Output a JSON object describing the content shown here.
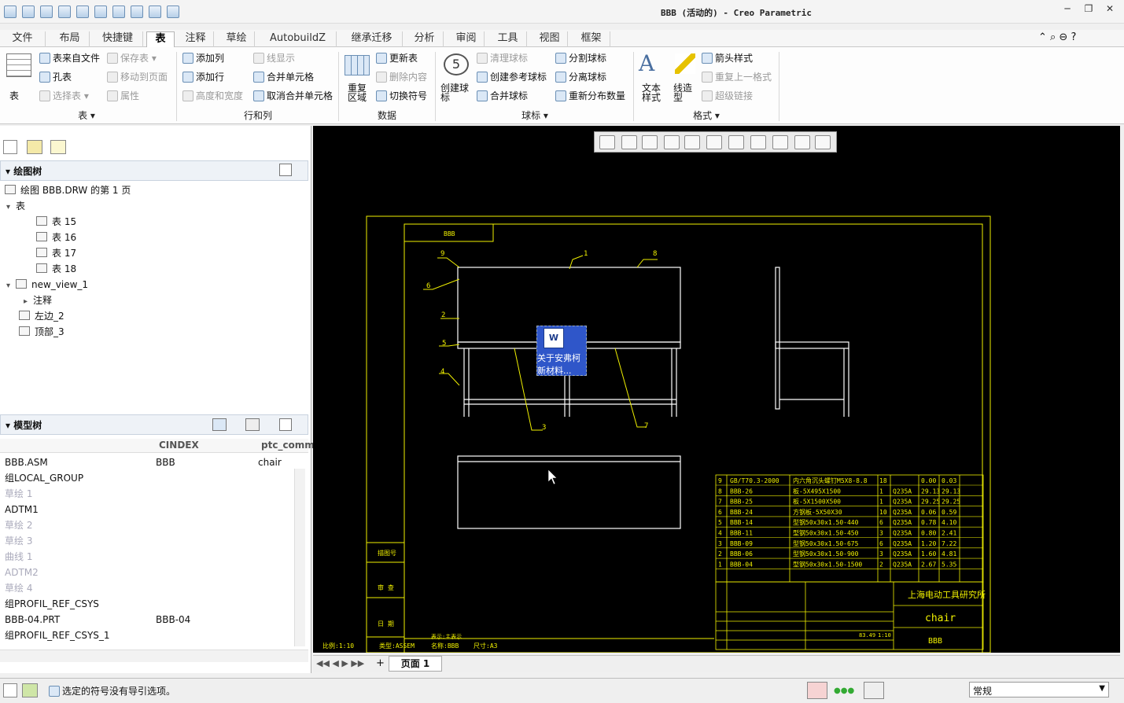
{
  "window": {
    "title": "BBB (活动的) - Creo Parametric",
    "minimize": "─",
    "restore": "❐",
    "close": "✕"
  },
  "menu_tabs": [
    "文件",
    "布局",
    "快捷键",
    "表",
    "注释",
    "草绘",
    "AutobuildZ",
    "继承迁移",
    "分析",
    "审阅",
    "工具",
    "视图",
    "框架"
  ],
  "ribbon": {
    "table_group": {
      "big": "表",
      "items": [
        "表来自文件",
        "孔表",
        "保存表",
        "移动到页面",
        "选择表",
        "属性"
      ],
      "label": "表"
    },
    "rowcol_group": {
      "items": [
        "添加列",
        "添加行",
        "高度和宽度",
        "线显示",
        "合并单元格",
        "取消合并单元格"
      ],
      "label": "行和列"
    },
    "data_group": {
      "big": "重复\n区域",
      "items": [
        "更新表",
        "删除内容",
        "切换符号"
      ],
      "label": "数据"
    },
    "balloon_group": {
      "big": "创建球\n标",
      "items": [
        "清理球标",
        "创建参考球标",
        "合并球标",
        "分割球标",
        "分离球标",
        "重新分布数量"
      ],
      "label": "球标"
    },
    "format_group": {
      "big1": "文本\n样式",
      "big2": "线造\n型",
      "items": [
        "箭头样式",
        "重复上一格式",
        "超级链接"
      ],
      "label": "格式"
    }
  },
  "drawing_tree": {
    "header": "绘图树",
    "root": "绘图 BBB.DRW 的第 1 页",
    "nodes": [
      "表",
      "表 15",
      "表 16",
      "表 17",
      "表 18",
      "new_view_1",
      "注释",
      "左边_2",
      "顶部_3"
    ]
  },
  "model_tree": {
    "header": "模型树",
    "columns": [
      "",
      "CINDEX",
      "ptc_comm"
    ],
    "rows": [
      {
        "name": "BBB.ASM",
        "c1": "BBB",
        "c2": "chair",
        "dim": false
      },
      {
        "name": "组LOCAL_GROUP",
        "c1": "",
        "c2": "",
        "dim": false
      },
      {
        "name": "草绘 1",
        "c1": "",
        "c2": "",
        "dim": true
      },
      {
        "name": "ADTM1",
        "c1": "",
        "c2": "",
        "dim": false
      },
      {
        "name": "草绘 2",
        "c1": "",
        "c2": "",
        "dim": true
      },
      {
        "name": "草绘 3",
        "c1": "",
        "c2": "",
        "dim": true
      },
      {
        "name": "曲线 1",
        "c1": "",
        "c2": "",
        "dim": true
      },
      {
        "name": "ADTM2",
        "c1": "",
        "c2": "",
        "dim": true
      },
      {
        "name": "草绘 4",
        "c1": "",
        "c2": "",
        "dim": true
      },
      {
        "name": "组PROFIL_REF_CSYS",
        "c1": "",
        "c2": "",
        "dim": false
      },
      {
        "name": "BBB-04.PRT",
        "c1": "BBB-04",
        "c2": "",
        "dim": false
      },
      {
        "name": "组PROFIL_REF_CSYS_1",
        "c1": "",
        "c2": "",
        "dim": false
      }
    ]
  },
  "drawing": {
    "title_box": "BBB",
    "balloons": [
      "1",
      "2",
      "3",
      "4",
      "5",
      "6",
      "7",
      "8",
      "9"
    ],
    "bom": [
      [
        "9",
        "GB/T70.3-2000",
        "内六角沉头螺钉M5X8-8.8",
        "18",
        "",
        "0.00",
        "0.03"
      ],
      [
        "8",
        "BBB-26",
        "板-5X495X1500",
        "1",
        "Q235A",
        "29.13",
        "29.13"
      ],
      [
        "7",
        "BBB-25",
        "板-5X1500X500",
        "1",
        "Q235A",
        "29.25",
        "29.25"
      ],
      [
        "6",
        "BBB-24",
        "方钢板-5X50X30",
        "10",
        "Q235A",
        "0.06",
        "0.59"
      ],
      [
        "5",
        "BBB-14",
        "型钢50x30x1.50-440",
        "6",
        "Q235A",
        "0.78",
        "4.10"
      ],
      [
        "4",
        "BBB-11",
        "型钢50x30x1.50-450",
        "3",
        "Q235A",
        "0.80",
        "2.41"
      ],
      [
        "3",
        "BBB-09",
        "型钢50x30x1.50-675",
        "6",
        "Q235A",
        "1.20",
        "7.22"
      ],
      [
        "2",
        "BBB-06",
        "型钢50x30x1.50-900",
        "3",
        "Q235A",
        "1.60",
        "4.81"
      ],
      [
        "1",
        "BBB-04",
        "型钢50x30x1.50-1500",
        "2",
        "Q235A",
        "2.67",
        "5.35"
      ]
    ],
    "company": "上海电动工具研究所",
    "part_name": "chair",
    "drawing_no": "BBB",
    "scale_label": "比例:1:10",
    "type_label": "类型:ASSEM",
    "name_label": "名称:BBB",
    "size_label": "尺寸:A3",
    "rep_label": "表示:主表示",
    "side_labels": [
      "描图号",
      "审 查",
      "日 期"
    ],
    "scale_cell": "1:10",
    "weight_cell": "83.49"
  },
  "floating_icon": {
    "line1": "关于安弗柯",
    "line2": "新材料..."
  },
  "page_bar": {
    "page_label": "页面 1",
    "add": "+"
  },
  "status": {
    "message": "选定的符号没有导引选项。",
    "filter": "常规"
  }
}
